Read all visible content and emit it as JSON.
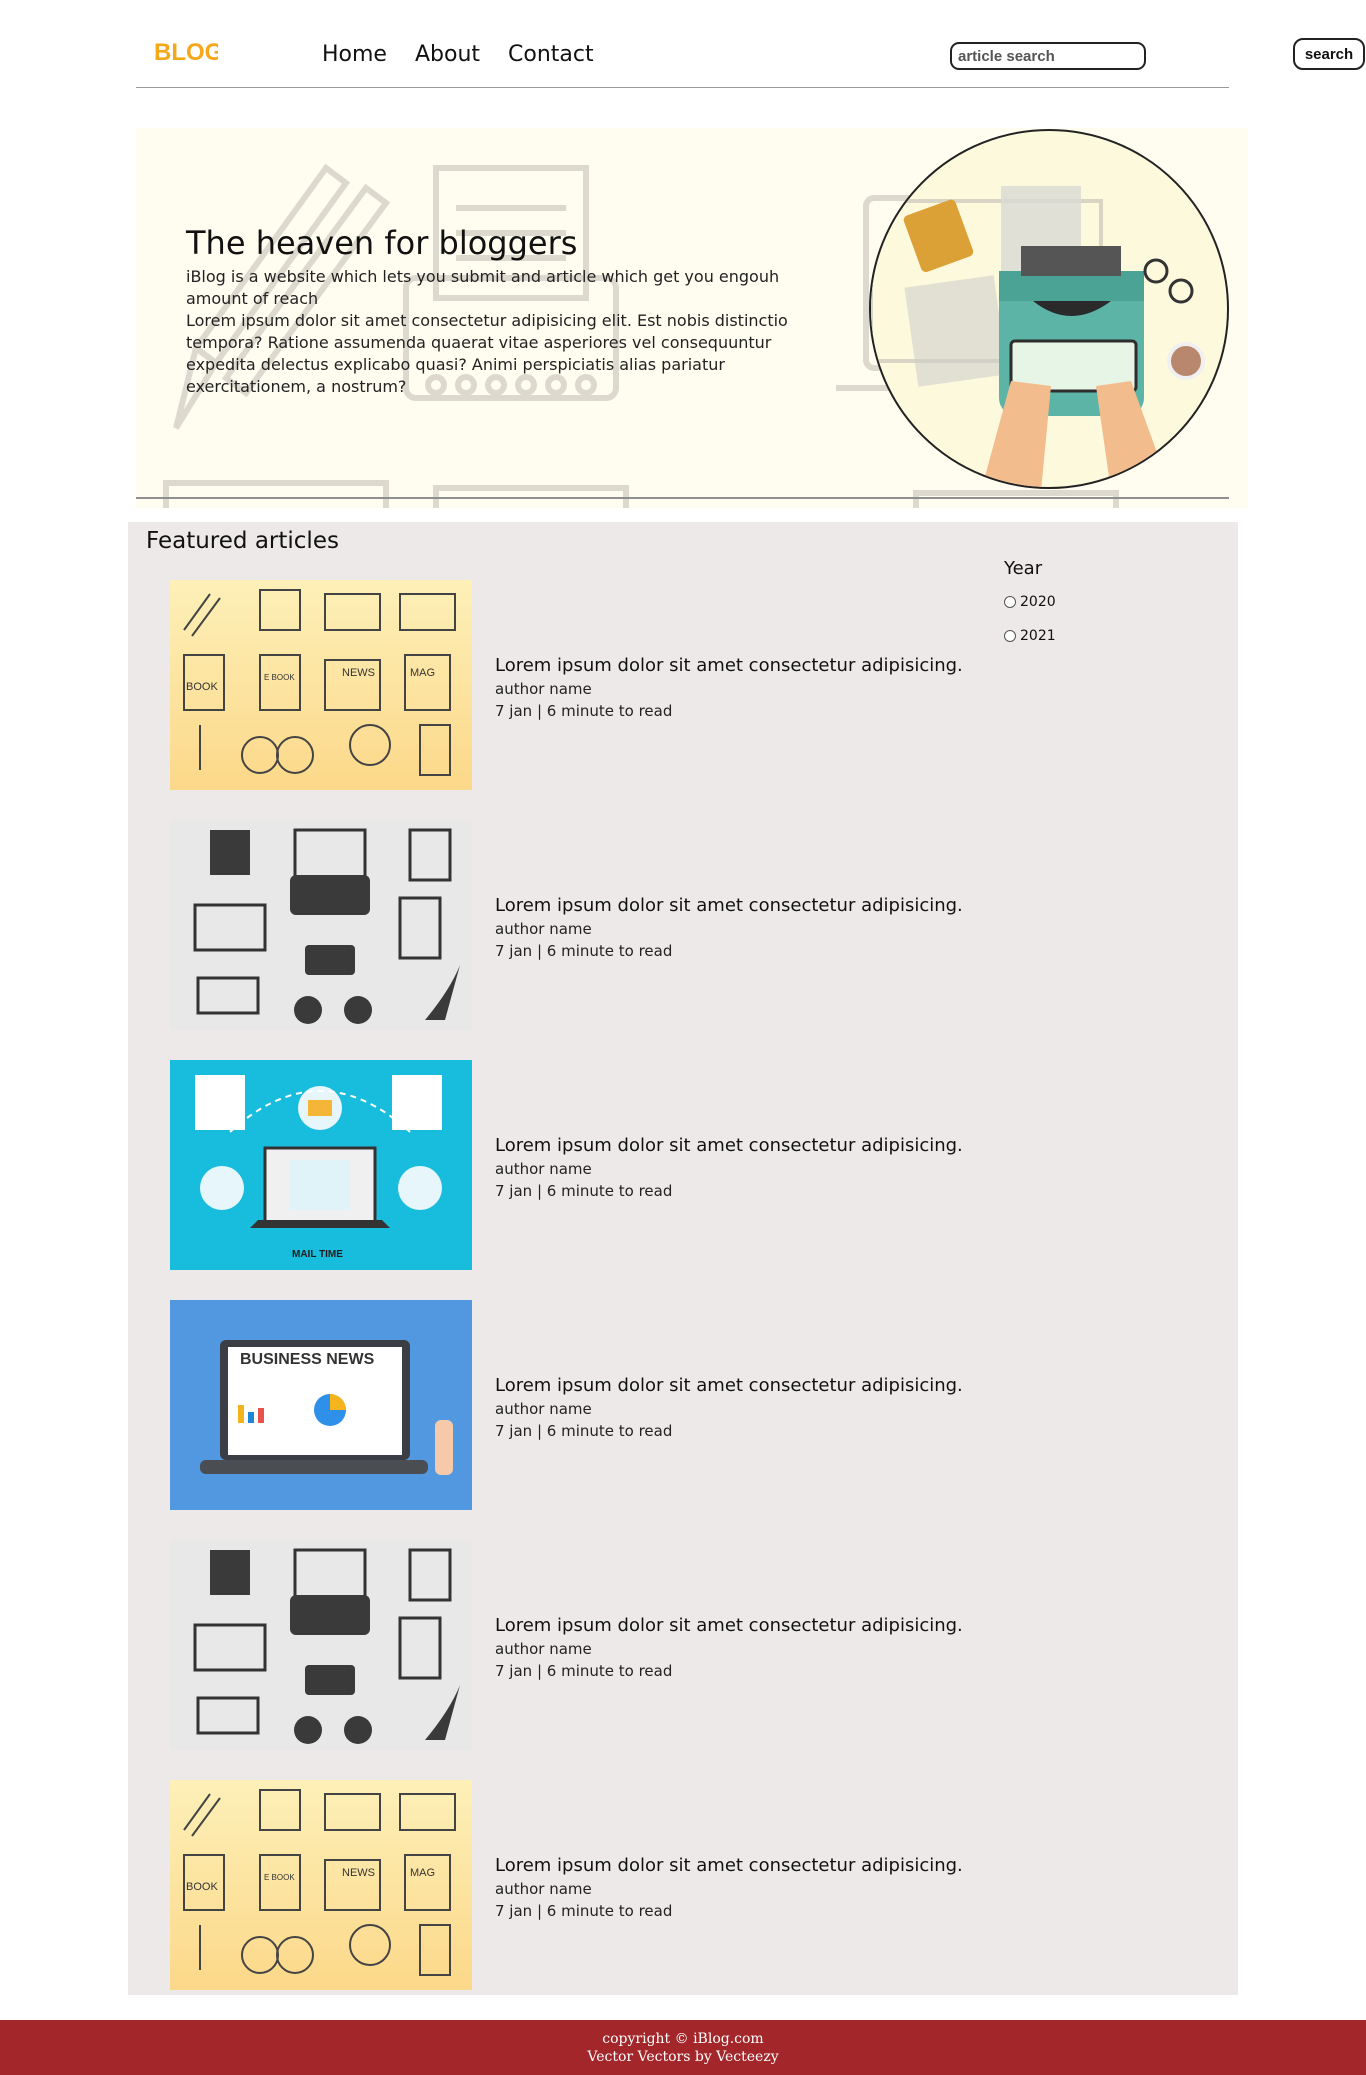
{
  "nav": {
    "logo_text": "BLOG",
    "links": [
      "Home",
      "About",
      "Contact"
    ],
    "search_placeholder": "article search",
    "search_label": "search"
  },
  "hero": {
    "title": "The heaven for bloggers",
    "intro": "iBlog is a website which lets you submit and article which get you engouh amount of reach",
    "body": "Lorem ipsum dolor sit amet consectetur adipisicing elit. Est nobis distinctio tempora? Ratione assumenda quaerat vitae asperiores vel consequuntur expedita delectus explicabo quasi? Animi perspiciatis alias pariatur exercitationem, a nostrum?"
  },
  "featured": {
    "title": "Featured articles",
    "articles": [
      {
        "title": "Lorem ipsum dolor sit amet consectetur adipisicing.",
        "author": "author name",
        "meta": "7 jan | 6 minute to read",
        "thumb": "icons-yellow"
      },
      {
        "title": "Lorem ipsum dolor sit amet consectetur adipisicing.",
        "author": "author name",
        "meta": "7 jan | 6 minute to read",
        "thumb": "icons-gray"
      },
      {
        "title": "Lorem ipsum dolor sit amet consectetur adipisicing.",
        "author": "author name",
        "meta": "7 jan | 6 minute to read",
        "thumb": "mail-time"
      },
      {
        "title": "Lorem ipsum dolor sit amet consectetur adipisicing.",
        "author": "author name",
        "meta": "7 jan | 6 minute to read",
        "thumb": "business-news"
      },
      {
        "title": "Lorem ipsum dolor sit amet consectetur adipisicing.",
        "author": "author name",
        "meta": "7 jan | 6 minute to read",
        "thumb": "icons-gray"
      },
      {
        "title": "Lorem ipsum dolor sit amet consectetur adipisicing.",
        "author": "author name",
        "meta": "7 jan | 6 minute to read",
        "thumb": "icons-yellow"
      }
    ],
    "thumb_labels": {
      "book": "BOOK",
      "ebook": "E BOOK",
      "news": "NEWS",
      "mag": "MAG",
      "mail_time": "MAIL TIME",
      "business_news": "BUSINESS NEWS"
    }
  },
  "filter": {
    "title": "Year",
    "options": [
      "2020",
      "2021"
    ]
  },
  "footer": {
    "copyright": "copyright © iBlog.com",
    "credit": "Vector Vectors by Vecteezy"
  },
  "colors": {
    "footer_bg": "#a3272a",
    "featured_bg": "#ede9e8",
    "hero_bg": "#fffcf0"
  }
}
